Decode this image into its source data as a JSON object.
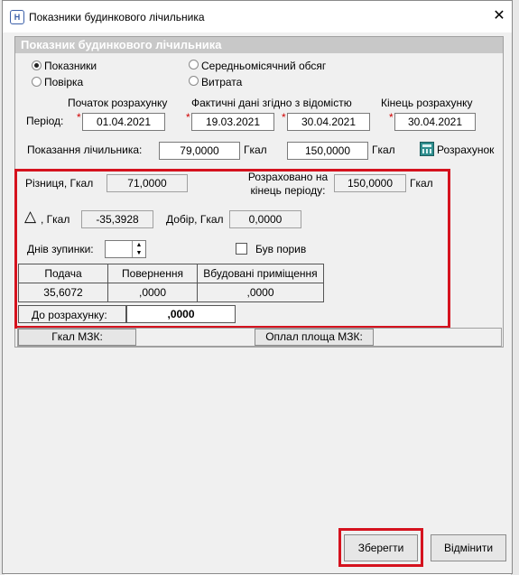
{
  "window": {
    "title": "Показники будинкового лічильника",
    "icon_letter": "Н",
    "close_glyph": "✕"
  },
  "group": {
    "header": "Показник будинкового лічильника"
  },
  "radios": {
    "pokaznyky": "Показники",
    "poverka": "Повірка",
    "serednomisyachnyi": "Середньомісячний обсяг",
    "vytrata": "Витрата",
    "selected": "pokaznyky"
  },
  "period": {
    "label": "Період:",
    "start_header": "Початок розрахунку",
    "actual_header": "Фактичні дані згідно з відомістю",
    "end_header": "Кінець розрахунку",
    "start": "01.04.2021",
    "actual_from": "19.03.2021",
    "actual_to": "30.04.2021",
    "end": "30.04.2021",
    "required_mark": "*"
  },
  "readings": {
    "label": "Показання лічильника:",
    "value1": "79,0000",
    "unit1": "Гкал",
    "value2": "150,0000",
    "unit2": "Гкал",
    "calc_button": "Розрахунок",
    "calc_icon": "calculator-icon"
  },
  "results": {
    "diff_label": "Різниця, Гкал",
    "diff_value": "71,0000",
    "calc_end_label_1": "Розраховано на",
    "calc_end_label_2": "кінець періоду:",
    "calc_end_value": "150,0000",
    "calc_end_unit": "Гкал",
    "delta_symbol": "△",
    "delta_label": ", Гкал",
    "delta_value": "-35,3928",
    "dobir_label": "Добір, Гкал",
    "dobir_value": "0,0000",
    "stop_days_label": "Днів зупинки:",
    "stop_days_value": "",
    "breach_label": "Був порив",
    "breach_checked": false
  },
  "table": {
    "headers": [
      "Подача",
      "Повернення",
      "Вбудовані приміщення"
    ],
    "row": [
      "35,6072",
      ",0000",
      ",0000"
    ]
  },
  "to_calc": {
    "label": "До розрахунку:",
    "value": ",0000"
  },
  "mzk": {
    "gkal_label": "Гкал МЗК:",
    "area_label": "Оплал площа МЗК:"
  },
  "buttons": {
    "save": "Зберегти",
    "cancel": "Відмінити"
  },
  "colors": {
    "highlight_red": "#d5121e",
    "group_header_bg": "#c8c8c8",
    "required_red": "#d00000"
  }
}
